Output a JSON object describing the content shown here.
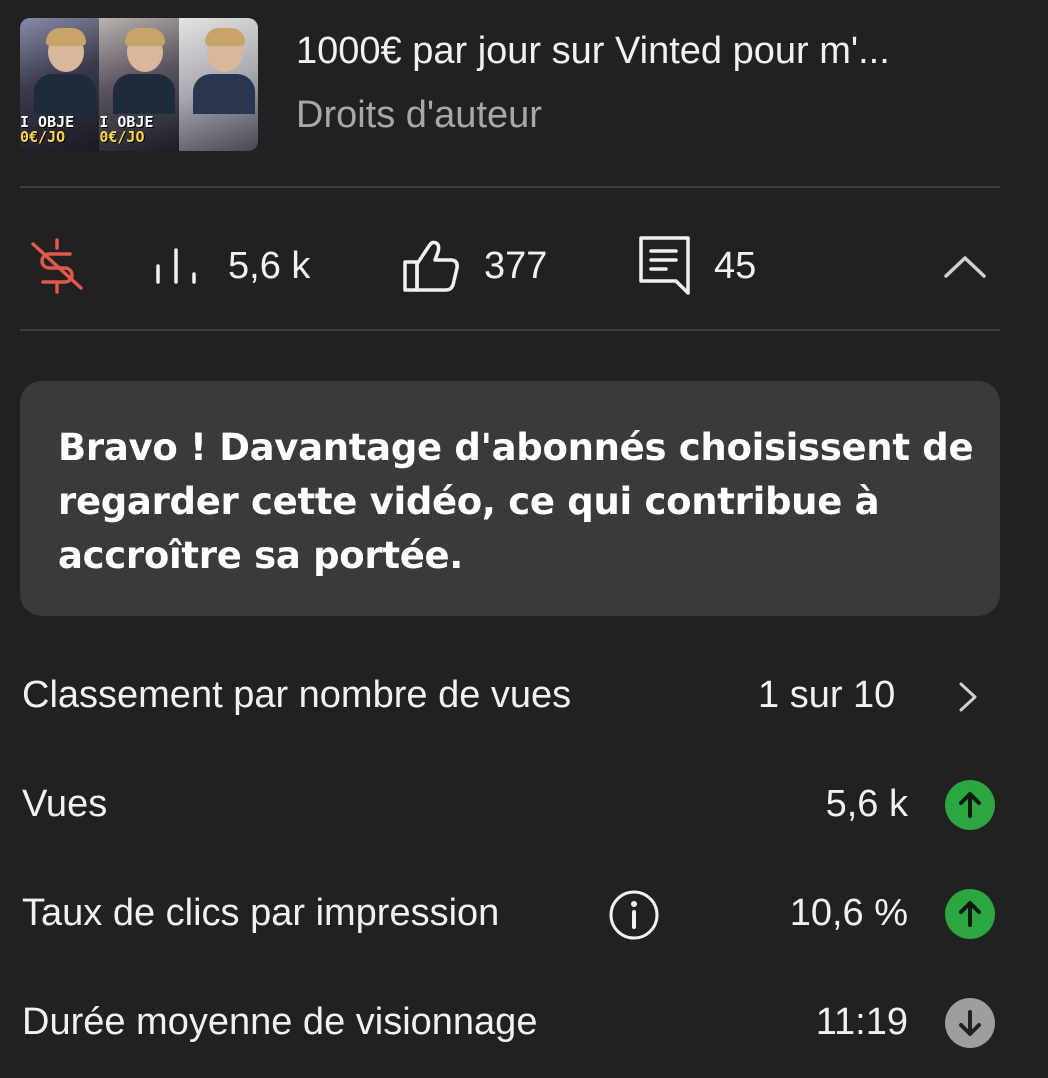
{
  "header": {
    "title": "1000€ par jour sur Vinted pour m'...",
    "subtitle": "Droits d'auteur",
    "thumbnail": {
      "frames": [
        {
          "caption_top": "I OBJE",
          "caption_bottom": "0€/JO"
        },
        {
          "caption_top": "I OBJE",
          "caption_bottom": "0€/JO"
        },
        {
          "caption_top": "",
          "caption_bottom": ""
        }
      ]
    }
  },
  "stats": {
    "monetization_icon": "no-monetization-icon",
    "views": "5,6 k",
    "likes": "377",
    "comments": "45",
    "collapse_icon": "chevron-up-icon"
  },
  "message": {
    "text": "Bravo ! Davantage d'abonnés choisissent de regarder cette vidéo, ce qui contribue à accroître sa portée."
  },
  "metrics": [
    {
      "label": "Classement par nombre de vues",
      "value": "1 sur 10",
      "trend": "chevron-right"
    },
    {
      "label": "Vues",
      "value": "5,6 k",
      "trend": "up"
    },
    {
      "label": "Taux de clics par impression",
      "value": "10,6 %",
      "trend": "up",
      "info": true
    },
    {
      "label": "Durée moyenne de visionnage",
      "value": "11:19",
      "trend": "down"
    }
  ],
  "colors": {
    "background": "#212121",
    "card": "#3a3a3a",
    "trend_up": "#2ba640",
    "trend_down": "#9e9e9e",
    "no_monetization": "#e0594b"
  }
}
